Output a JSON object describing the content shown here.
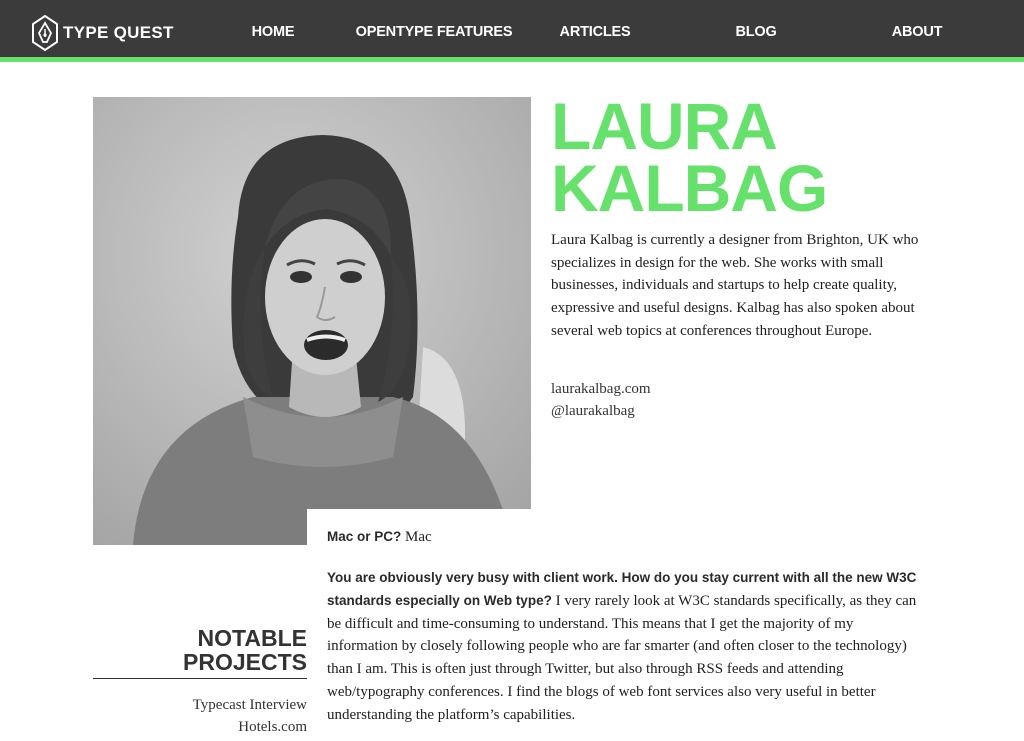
{
  "brand": {
    "name": "TYPE QUEST",
    "logo_icon": "pen-nib-icon"
  },
  "nav": {
    "items": [
      {
        "label": "HOME"
      },
      {
        "label": "OPENTYPE FEATURES"
      },
      {
        "label": "ARTICLES"
      },
      {
        "label": "BLOG"
      },
      {
        "label": "ABOUT"
      }
    ]
  },
  "colors": {
    "header_bg": "#3b3b3b",
    "accent": "#66e26c"
  },
  "profile": {
    "name_line1": "LAURA",
    "name_line2": "KALBAG",
    "bio": "Laura Kalbag is currently a designer from Brighton, UK who specializes in design for the web. She works with small businesses, individuals and startups to help create quality, expressive and useful designs. Kalbag has also spoken about several web topics at conferences throughout Europe.",
    "website": "laurakalbag.com",
    "twitter": "@laurakalbag"
  },
  "interview": {
    "q1": "Mac or PC?",
    "a1": "Mac",
    "q2": "You are obviously very busy with client work. How do you stay current with all the new W3C standards especially on Web type?",
    "a2": "I very rarely look at W3C standards specifically, as they can be difficult and time-consuming to understand. This means that I get the majority of my information by closely following people who are far smarter (and often closer to the technology) than I am. This is often just through Twitter, but also through RSS feeds and attending web/typography conferences. I find the blogs of web font services also very useful in better understanding the platform’s capabilities."
  },
  "notable_projects": {
    "title_line1": "NOTABLE",
    "title_line2": "PROJECTS",
    "items": [
      {
        "label": "Typecast Interview"
      },
      {
        "label": "Hotels.com"
      }
    ]
  }
}
